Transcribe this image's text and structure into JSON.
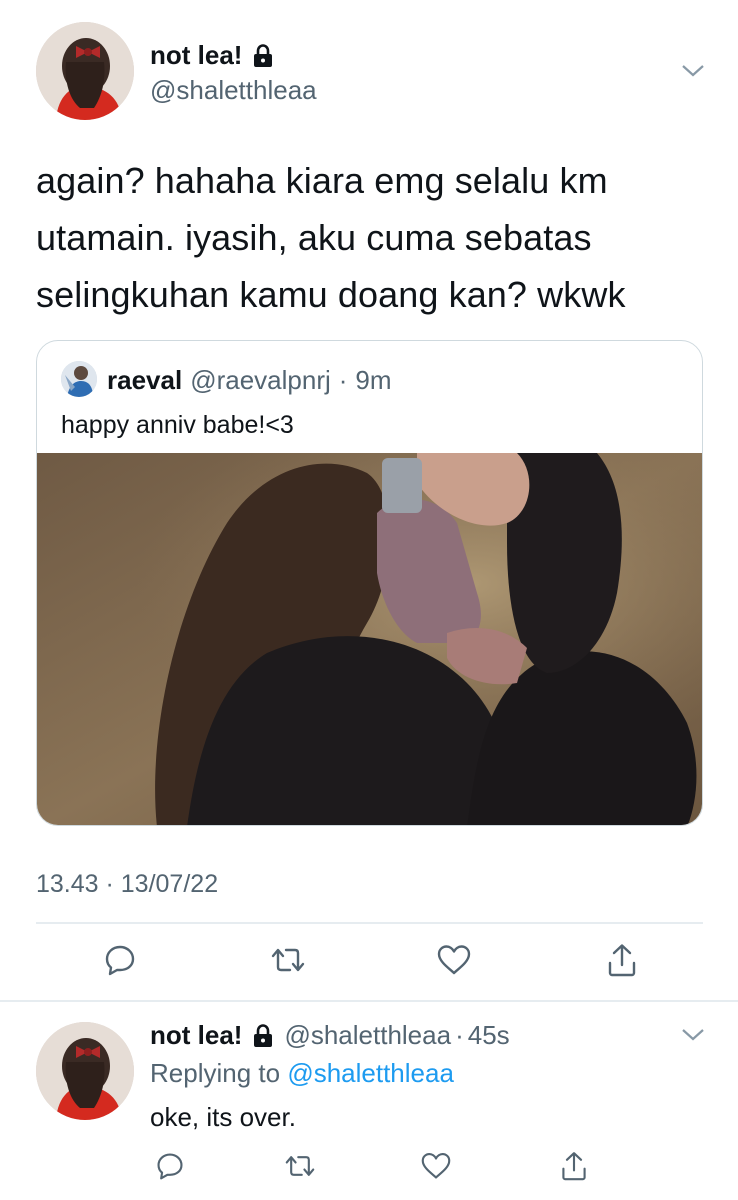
{
  "main_tweet": {
    "author_name": "not lea!",
    "author_handle": "@shaletthleaa",
    "text": "again? hahaha kiara emg selalu km utamain. iyasih, aku cuma sebatas selingkuhan kamu doang kan? wkwk",
    "quote": {
      "name": "raeval",
      "handle": "@raevalpnrj",
      "separator": "·",
      "time": "9m",
      "text": "happy anniv babe!<3"
    },
    "timestamp": "13.43 · 13/07/22"
  },
  "reply_tweet": {
    "author_name": "not lea!",
    "author_handle": "@shaletthleaa",
    "separator": "·",
    "time": "45s",
    "replying_prefix": "Replying to",
    "replying_mention": "@shaletthleaa",
    "text": "oke, its over."
  },
  "icons": {
    "lock": "lock-icon",
    "more": "chevron-down-icon",
    "reply": "reply-icon",
    "retweet": "retweet-icon",
    "like": "heart-icon",
    "share": "share-icon"
  },
  "colors": {
    "text_primary": "#0f1419",
    "text_secondary": "#536471",
    "link": "#1d9bf0",
    "border": "#cfd9de"
  }
}
